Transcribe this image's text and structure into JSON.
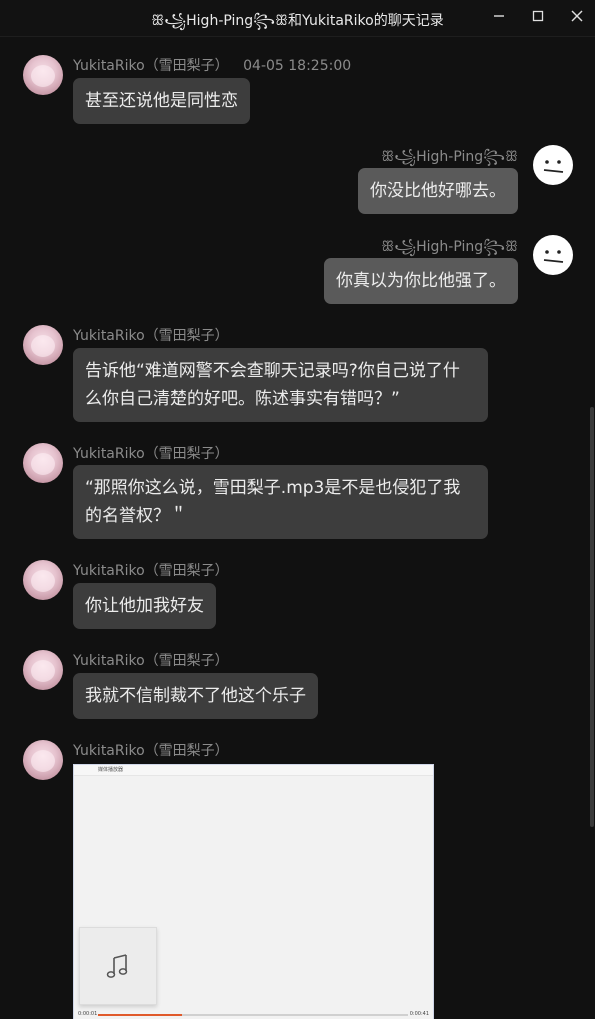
{
  "window": {
    "title": "ꕥ꧁High-Ping꧂ꕥ和YukitaRiko的聊天记录",
    "min_icon": "minimize-icon",
    "max_icon": "maximize-icon",
    "close_icon": "close-icon"
  },
  "messages": [
    {
      "side": "in",
      "sender": "YukitaRiko（雪田梨子）",
      "time": "04-05 18:25:00",
      "text": "甚至还说他是同性恋"
    },
    {
      "side": "out",
      "sender": "ꕥ꧁High-Ping꧂ꕥ",
      "text": "你没比他好哪去。"
    },
    {
      "side": "out",
      "sender": "ꕥ꧁High-Ping꧂ꕥ",
      "text": "你真以为你比他强了。"
    },
    {
      "side": "in",
      "sender": "YukitaRiko（雪田梨子）",
      "lines": [
        "告诉他“难道网警不会查聊天记录吗?你自己说了什",
        "么你自己清楚的好吧。陈述事实有错吗？”"
      ]
    },
    {
      "side": "in",
      "sender": "YukitaRiko（雪田梨子）",
      "lines": [
        "“那照你这么说，雪田梨子.mp3是不是也侵犯了我",
        "的名誉权？＂"
      ]
    },
    {
      "side": "in",
      "sender": "YukitaRiko（雪田梨子）",
      "text": "你让他加我好友"
    },
    {
      "side": "in",
      "sender": "YukitaRiko（雪田梨子）",
      "text": "我就不信制裁不了他这个乐子"
    },
    {
      "side": "in",
      "sender": "YukitaRiko（雪田梨子）",
      "image": {
        "window_title": "媒体播放器",
        "time_left": "0:00:01",
        "time_right": "0:00:41",
        "progress": 0.27,
        "icon": "music-note-icon"
      }
    }
  ],
  "colors": {
    "background": "#111111",
    "bubble_in": "#3d3d3d",
    "bubble_out": "#5a5a5a",
    "sender_text": "#8b8b8b",
    "progress": "#e05a2b"
  }
}
